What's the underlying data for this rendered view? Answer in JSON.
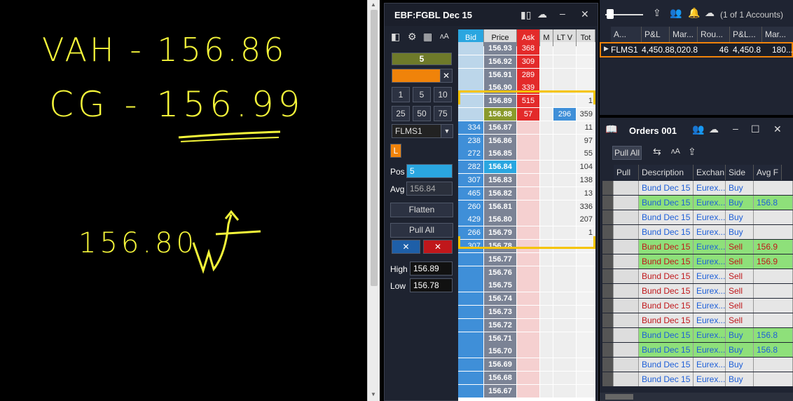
{
  "board": {
    "line1": "VAH - 156.86",
    "line2": "CG - 156.99",
    "line3": "156.80"
  },
  "dom": {
    "title": "EBF:FGBL Dec 15",
    "qty": "5",
    "quick_qty": [
      "1",
      "5",
      "10",
      "25",
      "50",
      "75"
    ],
    "account": "FLMS1",
    "l_badge": "L",
    "pos_label": "Pos",
    "pos_value": "5",
    "avg_label": "Avg",
    "avg_value": "156.84",
    "flatten": "Flatten",
    "pull_all": "Pull All",
    "cancel_buy": "✕",
    "cancel_sell": "✕",
    "high_label": "High",
    "high_value": "156.89",
    "low_label": "Low",
    "low_value": "156.78",
    "headers": {
      "bid": "Bid",
      "price": "Price",
      "ask": "Ask",
      "m": "M",
      "lt": "LT V",
      "tot": "Tot"
    },
    "rows": [
      {
        "bid": "",
        "price": "156.93",
        "ask": "368",
        "lt": "",
        "tot": ""
      },
      {
        "bid": "",
        "price": "156.92",
        "ask": "309",
        "lt": "",
        "tot": ""
      },
      {
        "bid": "",
        "price": "156.91",
        "ask": "289",
        "lt": "",
        "tot": ""
      },
      {
        "bid": "",
        "price": "156.90",
        "ask": "339",
        "lt": "",
        "tot": ""
      },
      {
        "bid": "",
        "price": "156.89",
        "ask": "515",
        "lt": "",
        "tot": "1"
      },
      {
        "bid": "",
        "price": "156.88",
        "ask": "57",
        "lt": "296",
        "tot": "359"
      },
      {
        "bid": "334",
        "price": "156.87",
        "ask": "",
        "lt": "",
        "tot": "11"
      },
      {
        "bid": "238",
        "price": "156.86",
        "ask": "",
        "lt": "",
        "tot": "97"
      },
      {
        "bid": "272",
        "price": "156.85",
        "ask": "",
        "lt": "",
        "tot": "55"
      },
      {
        "bid": "282",
        "price": "156.84",
        "ask": "",
        "lt": "",
        "tot": "104"
      },
      {
        "bid": "307",
        "price": "156.83",
        "ask": "",
        "lt": "",
        "tot": "138"
      },
      {
        "bid": "465",
        "price": "156.82",
        "ask": "",
        "lt": "",
        "tot": "13"
      },
      {
        "bid": "260",
        "price": "156.81",
        "ask": "",
        "lt": "",
        "tot": "336"
      },
      {
        "bid": "429",
        "price": "156.80",
        "ask": "",
        "lt": "",
        "tot": "207"
      },
      {
        "bid": "266",
        "price": "156.79",
        "ask": "",
        "lt": "",
        "tot": "1"
      },
      {
        "bid": "307",
        "price": "156.78",
        "ask": "",
        "lt": "",
        "tot": ""
      },
      {
        "bid": "",
        "price": "156.77",
        "ask": "",
        "lt": "",
        "tot": ""
      },
      {
        "bid": "",
        "price": "156.76",
        "ask": "",
        "lt": "",
        "tot": ""
      },
      {
        "bid": "",
        "price": "156.75",
        "ask": "",
        "lt": "",
        "tot": ""
      },
      {
        "bid": "",
        "price": "156.74",
        "ask": "",
        "lt": "",
        "tot": ""
      },
      {
        "bid": "",
        "price": "156.73",
        "ask": "",
        "lt": "",
        "tot": ""
      },
      {
        "bid": "",
        "price": "156.72",
        "ask": "",
        "lt": "",
        "tot": ""
      },
      {
        "bid": "",
        "price": "156.71",
        "ask": "",
        "lt": "",
        "tot": ""
      },
      {
        "bid": "",
        "price": "156.70",
        "ask": "",
        "lt": "",
        "tot": ""
      },
      {
        "bid": "",
        "price": "156.69",
        "ask": "",
        "lt": "",
        "tot": ""
      },
      {
        "bid": "",
        "price": "156.68",
        "ask": "",
        "lt": "",
        "tot": ""
      },
      {
        "bid": "",
        "price": "156.67",
        "ask": "",
        "lt": "",
        "tot": ""
      }
    ]
  },
  "accounts": {
    "count": "(1 of 1 Accounts)",
    "headers": [
      "A...",
      "P&L",
      "Mar...",
      "Rou...",
      "P&L...",
      "Mar..."
    ],
    "row": [
      "FLMS1",
      "4,450.8",
      "8,020.8",
      "46",
      "4,450.8",
      "180..."
    ]
  },
  "orders": {
    "title": "Orders 001",
    "pull_all": "Pull All",
    "headers": [
      "Pull",
      "Description",
      "Exchan",
      "Side",
      "Avg F"
    ],
    "rows": [
      {
        "desc": "Bund Dec 15",
        "exch": "Eurex...",
        "side": "Buy",
        "avg": "",
        "fill": false
      },
      {
        "desc": "Bund Dec 15",
        "exch": "Eurex...",
        "side": "Buy",
        "avg": "156.8",
        "fill": true
      },
      {
        "desc": "Bund Dec 15",
        "exch": "Eurex...",
        "side": "Buy",
        "avg": "",
        "fill": false
      },
      {
        "desc": "Bund Dec 15",
        "exch": "Eurex...",
        "side": "Buy",
        "avg": "",
        "fill": false
      },
      {
        "desc": "Bund Dec 15",
        "exch": "Eurex...",
        "side": "Sell",
        "avg": "156.9",
        "fill": true
      },
      {
        "desc": "Bund Dec 15",
        "exch": "Eurex...",
        "side": "Sell",
        "avg": "156.9",
        "fill": true
      },
      {
        "desc": "Bund Dec 15",
        "exch": "Eurex...",
        "side": "Sell",
        "avg": "",
        "fill": false
      },
      {
        "desc": "Bund Dec 15",
        "exch": "Eurex...",
        "side": "Sell",
        "avg": "",
        "fill": false
      },
      {
        "desc": "Bund Dec 15",
        "exch": "Eurex...",
        "side": "Sell",
        "avg": "",
        "fill": false
      },
      {
        "desc": "Bund Dec 15",
        "exch": "Eurex...",
        "side": "Sell",
        "avg": "",
        "fill": false
      },
      {
        "desc": "Bund Dec 15",
        "exch": "Eurex...",
        "side": "Buy",
        "avg": "156.8",
        "fill": true
      },
      {
        "desc": "Bund Dec 15",
        "exch": "Eurex...",
        "side": "Buy",
        "avg": "156.8",
        "fill": true
      },
      {
        "desc": "Bund Dec 15",
        "exch": "Eurex...",
        "side": "Buy",
        "avg": "",
        "fill": false
      },
      {
        "desc": "Bund Dec 15",
        "exch": "Eurex...",
        "side": "Buy",
        "avg": "",
        "fill": false
      }
    ]
  },
  "colors": {
    "accent": "#3f8fd8",
    "ask": "#e32a2a",
    "highlight": "#f5c400",
    "fill": "#8ee07a",
    "ink": "#f4f53a"
  }
}
